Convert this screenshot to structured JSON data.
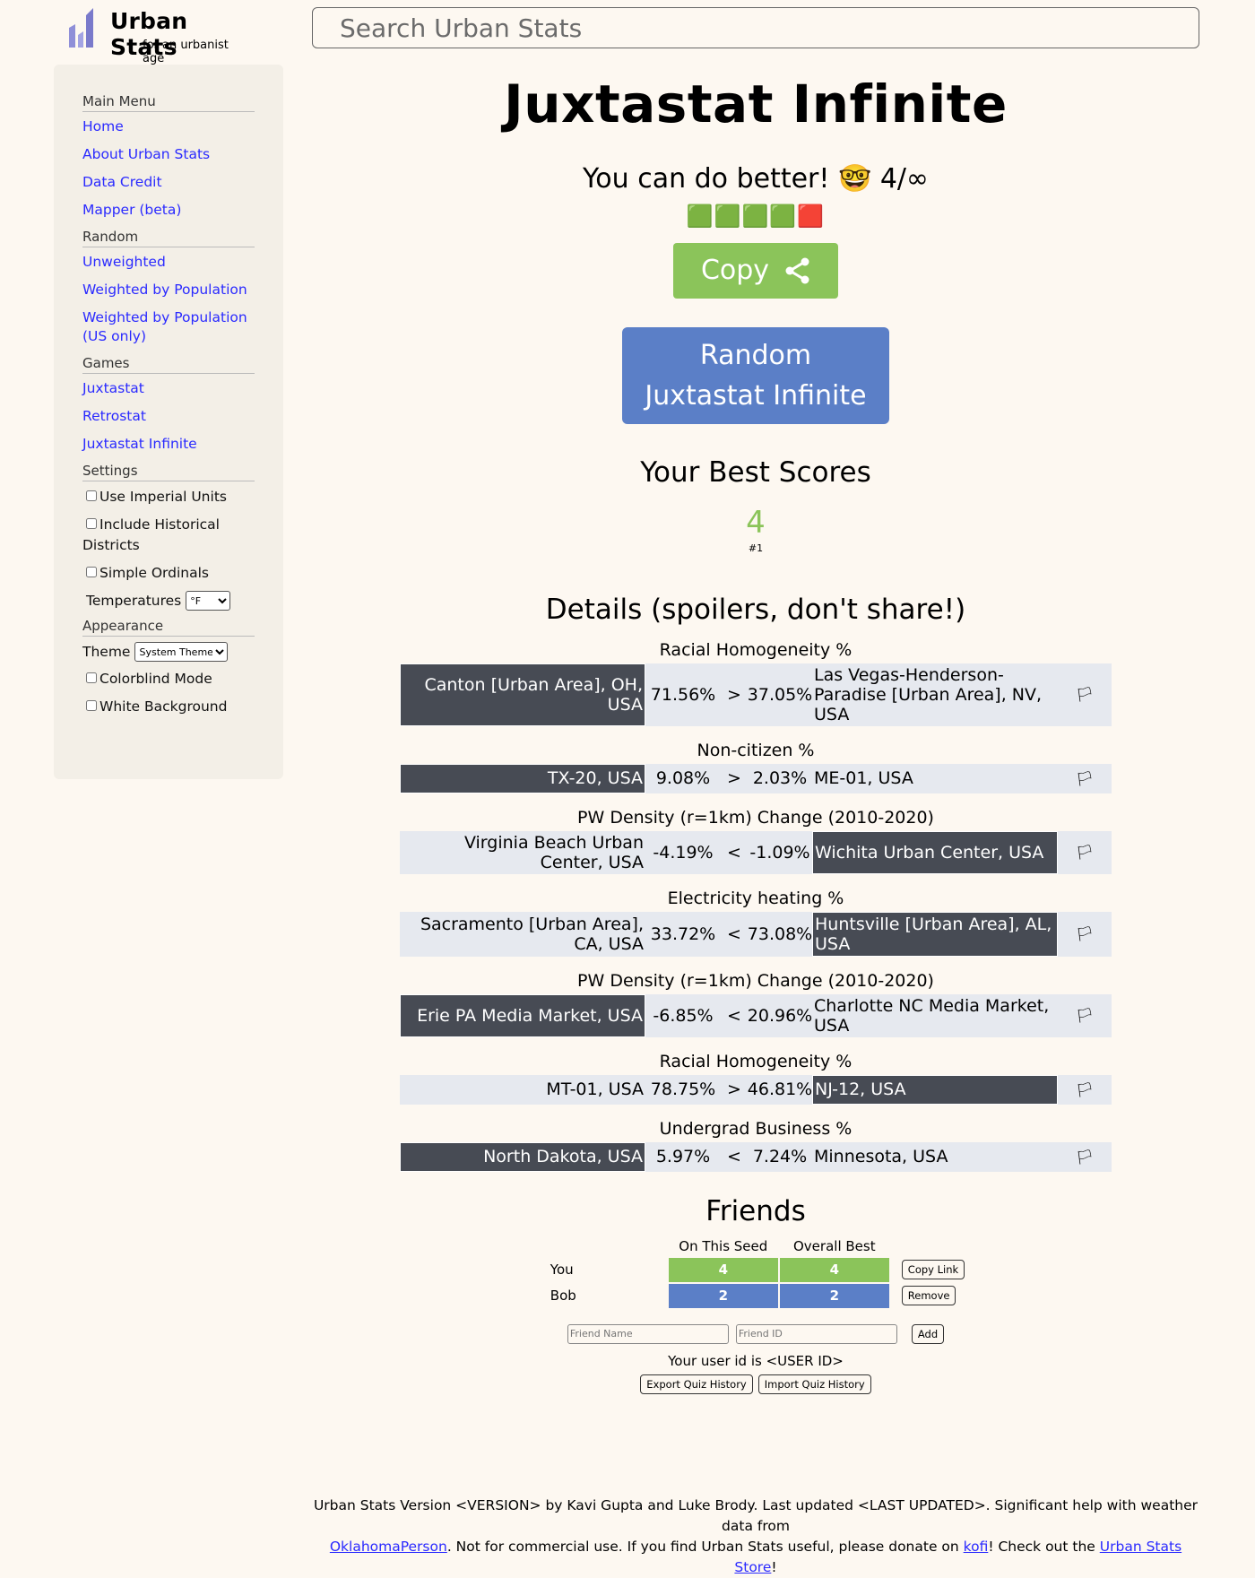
{
  "header": {
    "logo_title": "Urban Stats",
    "logo_subtitle": "for an urbanist age",
    "search_placeholder": "Search Urban Stats"
  },
  "sidebar": {
    "sections": {
      "main_menu": "Main Menu",
      "random": "Random",
      "games": "Games",
      "settings": "Settings",
      "appearance": "Appearance"
    },
    "main_menu_items": [
      "Home",
      "About Urban Stats",
      "Data Credit",
      "Mapper (beta)"
    ],
    "random_items": [
      "Unweighted",
      "Weighted by Population",
      "Weighted by Population (US only)"
    ],
    "games_items": [
      "Juxtastat",
      "Retrostat",
      "Juxtastat Infinite"
    ],
    "settings": {
      "imperial": "Use Imperial Units",
      "historical": "Include Historical Districts",
      "ordinals": "Simple Ordinals",
      "temperatures_label": "Temperatures",
      "temperatures_value": "°F"
    },
    "appearance": {
      "theme_label": "Theme",
      "theme_value": "System Theme",
      "colorblind": "Colorblind Mode",
      "white_bg": "White Background"
    }
  },
  "main": {
    "title": "Juxtastat Infinite",
    "result_line": "You can do better! 🤓 4/∞",
    "emoji_line": "🟩🟩🟩🟩🟥",
    "copy_label": "Copy",
    "random_button": "Random Juxtastat Infinite",
    "best_scores_title": "Your Best Scores",
    "best_score": "4",
    "best_rank": "#1",
    "details_title": "Details (spoilers, don't share!)",
    "questions": [
      {
        "stat": "Racial Homogeneity %",
        "left": "Canton [Urban Area], OH, USA",
        "left_value": "71.56%",
        "op": ">",
        "right_value": "37.05%",
        "right": "Las Vegas-Henderson-Paradise [Urban Area], NV, USA",
        "flag": "🏳",
        "correct_side": "left"
      },
      {
        "stat": "Non-citizen %",
        "left": "TX-20, USA",
        "left_value": "9.08%",
        "op": ">",
        "right_value": "2.03%",
        "right": "ME-01, USA",
        "flag": "🏳",
        "correct_side": "left"
      },
      {
        "stat": "PW Density (r=1km) Change (2010-2020)",
        "left": "Virginia Beach Urban Center, USA",
        "left_value": "-4.19%",
        "op": "<",
        "right_value": "-1.09%",
        "right": "Wichita Urban Center, USA",
        "flag": "🏳",
        "correct_side": "right"
      },
      {
        "stat": "Electricity heating %",
        "left": "Sacramento [Urban Area], CA, USA",
        "left_value": "33.72%",
        "op": "<",
        "right_value": "73.08%",
        "right": "Huntsville [Urban Area], AL, USA",
        "flag": "🏳",
        "correct_side": "right"
      },
      {
        "stat": "PW Density (r=1km) Change (2010-2020)",
        "left": "Erie PA Media Market, USA",
        "left_value": "-6.85%",
        "op": "<",
        "right_value": "20.96%",
        "right": "Charlotte NC Media Market, USA",
        "flag": "🏳",
        "correct_side": "left"
      },
      {
        "stat": "Racial Homogeneity %",
        "left": "MT-01, USA",
        "left_value": "78.75%",
        "op": ">",
        "right_value": "46.81%",
        "right": "NJ-12, USA",
        "flag": "🏳",
        "correct_side": "right"
      },
      {
        "stat": "Undergrad Business %",
        "left": "North Dakota, USA",
        "left_value": "5.97%",
        "op": "<",
        "right_value": "7.24%",
        "right": "Minnesota, USA",
        "flag": "🏳",
        "correct_side": "left"
      }
    ],
    "friends": {
      "title": "Friends",
      "col_seed": "On This Seed",
      "col_best": "Overall Best",
      "rows": [
        {
          "name": "You",
          "seed": "4",
          "best": "4",
          "action": "Copy Link",
          "color": "#8bc45a"
        },
        {
          "name": "Bob",
          "seed": "2",
          "best": "2",
          "action": "Remove",
          "color": "#5b7fc7"
        }
      ],
      "name_placeholder": "Friend Name",
      "id_placeholder": "Friend ID",
      "add_label": "Add",
      "user_id_text": "Your user id is <USER ID>",
      "export_label": "Export Quiz History",
      "import_label": "Import Quiz History"
    }
  },
  "footer": {
    "line1": "Urban Stats Version <VERSION> by Kavi Gupta and Luke Brody. Last updated <LAST UPDATED>. Significant help with weather data from",
    "link1": "OklahomaPerson",
    "text2": ". Not for commercial use. If you find Urban Stats useful, please donate on ",
    "link2": "kofi",
    "text3": "! Check out the ",
    "link3": "Urban Stats Store",
    "text4": "!"
  },
  "colors": {
    "background": "#fdf8f1",
    "sidebar": "#f3efe7",
    "link": "#2a2aff",
    "green": "#8bc45a",
    "blue": "#5b7fc7",
    "dark_cell": "#474b54",
    "row": "#e6e9ef"
  }
}
